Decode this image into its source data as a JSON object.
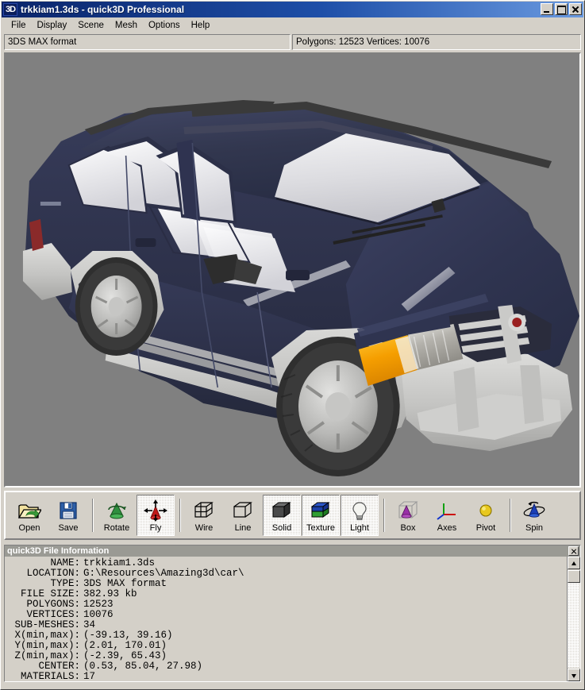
{
  "window": {
    "logo": "3D",
    "title": "trkkiam1.3ds - quick3D Professional",
    "minimize_label": "minimize",
    "maximize_label": "maximize",
    "close_label": "close"
  },
  "menu": {
    "items": [
      {
        "label": "File"
      },
      {
        "label": "Display"
      },
      {
        "label": "Scene"
      },
      {
        "label": "Mesh"
      },
      {
        "label": "Options"
      },
      {
        "label": "Help"
      }
    ]
  },
  "status": {
    "format": "3DS MAX format",
    "counts": "Polygons: 12523  Vertices: 10076"
  },
  "viewport": {
    "background_color": "#808080",
    "model_name": "trkkiam1.3ds",
    "body_color": "#2e3350",
    "trim_color": "#c8c8c8",
    "glass_color": "#e8e8ea",
    "tire_color": "#3a3a3a",
    "signal_color": "#f0a000"
  },
  "toolbar": {
    "tools": [
      {
        "label": "Open",
        "icon": "open-folder-icon",
        "active": false
      },
      {
        "label": "Save",
        "icon": "floppy-disk-icon",
        "active": false
      },
      {
        "label": "Rotate",
        "icon": "rotate-cone-icon",
        "active": false
      },
      {
        "label": "Fly",
        "icon": "fly-arrows-icon",
        "active": true
      },
      {
        "label": "Wire",
        "icon": "wireframe-cube-icon",
        "active": false
      },
      {
        "label": "Line",
        "icon": "line-cube-icon",
        "active": false
      },
      {
        "label": "Solid",
        "icon": "solid-cube-icon",
        "active": true
      },
      {
        "label": "Texture",
        "icon": "texture-cube-icon",
        "active": true
      },
      {
        "label": "Light",
        "icon": "lightbulb-icon",
        "active": true
      },
      {
        "label": "Box",
        "icon": "bounding-box-icon",
        "active": false
      },
      {
        "label": "Axes",
        "icon": "axes-icon",
        "active": false
      },
      {
        "label": "Pivot",
        "icon": "pivot-sphere-icon",
        "active": false
      },
      {
        "label": "Spin",
        "icon": "spin-orbit-icon",
        "active": false
      }
    ]
  },
  "info_panel": {
    "title": "quick3D File Information",
    "close_label": "close",
    "rows": [
      {
        "label": "NAME:",
        "value": "trkkiam1.3ds"
      },
      {
        "label": "LOCATION:",
        "value": "G:\\Resources\\Amazing3d\\car\\"
      },
      {
        "label": "TYPE:",
        "value": "3DS MAX format"
      },
      {
        "label": "FILE SIZE:",
        "value": "382.93 kb"
      },
      {
        "label": "POLYGONS:",
        "value": "12523"
      },
      {
        "label": "VERTICES:",
        "value": "10076"
      },
      {
        "label": "SUB-MESHES:",
        "value": "34"
      },
      {
        "label": "X(min,max):",
        "value": "(-39.13, 39.16)"
      },
      {
        "label": "Y(min,max):",
        "value": "(2.01, 170.01)"
      },
      {
        "label": "Z(min,max):",
        "value": "(-2.39, 65.43)"
      },
      {
        "label": "CENTER:",
        "value": "(0.53, 85.04, 27.98)"
      },
      {
        "label": "MATERIALS:",
        "value": "17"
      }
    ]
  }
}
